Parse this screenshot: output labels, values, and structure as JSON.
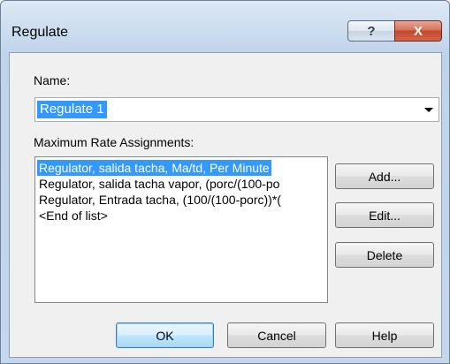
{
  "window": {
    "title": "Regulate",
    "help_glyph": "?",
    "close_glyph": "X"
  },
  "name_field": {
    "label": "Name:",
    "value": "Regulate 1"
  },
  "assignments": {
    "label": "Maximum Rate Assignments:",
    "items": [
      "Regulator, salida tacha, Ma/td, Per Minute",
      "Regulator, salida tacha vapor, (porc/(100-po",
      "Regulator, Entrada tacha, (100/(100-porc))*(",
      "<End of list>"
    ],
    "selected_index": 0
  },
  "side_buttons": {
    "add": "Add...",
    "edit": "Edit...",
    "delete": "Delete"
  },
  "footer_buttons": {
    "ok": "OK",
    "cancel": "Cancel",
    "help": "Help"
  }
}
